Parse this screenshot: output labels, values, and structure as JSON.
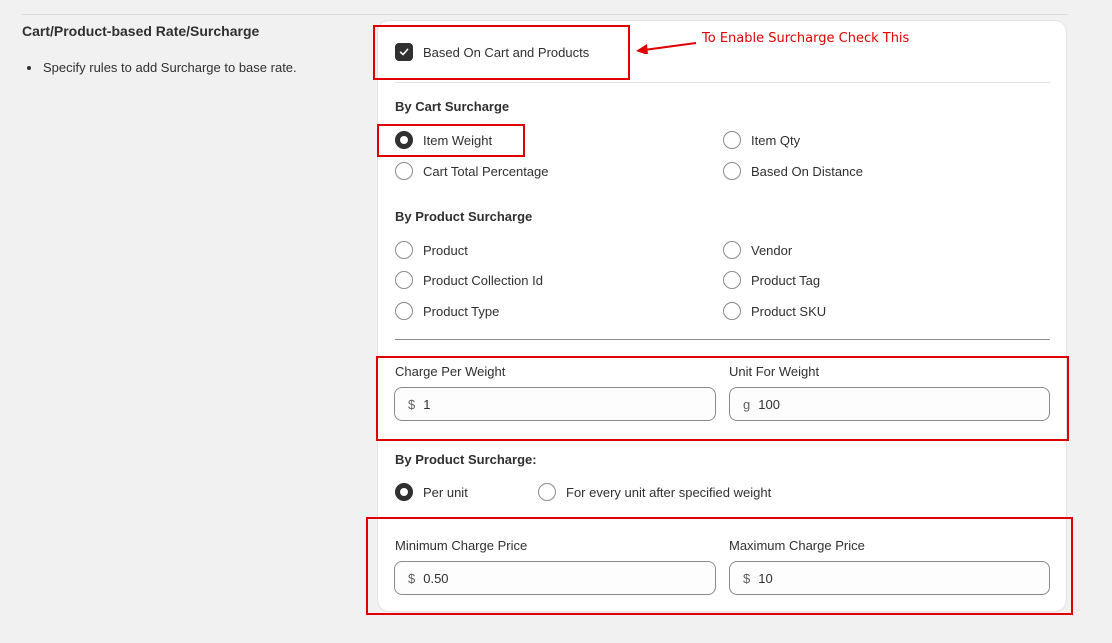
{
  "section": {
    "title": "Cart/Product-based Rate/Surcharge",
    "description": "Specify rules to add Surcharge to base rate."
  },
  "enable": {
    "label": "Based On Cart and Products",
    "checked": true,
    "annotation": "To Enable Surcharge Check This"
  },
  "cart_surcharge": {
    "title": "By Cart Surcharge",
    "options": [
      {
        "label": "Item Weight",
        "checked": true
      },
      {
        "label": "Item Qty",
        "checked": false
      },
      {
        "label": "Cart Total Percentage",
        "checked": false
      },
      {
        "label": "Based On Distance",
        "checked": false
      }
    ]
  },
  "product_surcharge": {
    "title": "By Product Surcharge",
    "options": [
      {
        "label": "Product",
        "checked": false
      },
      {
        "label": "Vendor",
        "checked": false
      },
      {
        "label": "Product Collection Id",
        "checked": false
      },
      {
        "label": "Product Tag",
        "checked": false
      },
      {
        "label": "Product Type",
        "checked": false
      },
      {
        "label": "Product SKU",
        "checked": false
      }
    ]
  },
  "weight": {
    "charge_label": "Charge Per Weight",
    "charge_prefix": "$",
    "charge_value": "1",
    "unit_label": "Unit For Weight",
    "unit_prefix": "g",
    "unit_value": "100"
  },
  "product_mode": {
    "title": "By Product Surcharge:",
    "options": [
      {
        "label": "Per unit",
        "checked": true
      },
      {
        "label": "For every unit after specified weight",
        "checked": false
      }
    ]
  },
  "limits": {
    "min_label": "Minimum Charge Price",
    "min_prefix": "$",
    "min_value": "0.50",
    "max_label": "Maximum Charge Price",
    "max_prefix": "$",
    "max_value": "10"
  },
  "colors": {
    "highlight": "#e00000",
    "checked": "#303030"
  }
}
